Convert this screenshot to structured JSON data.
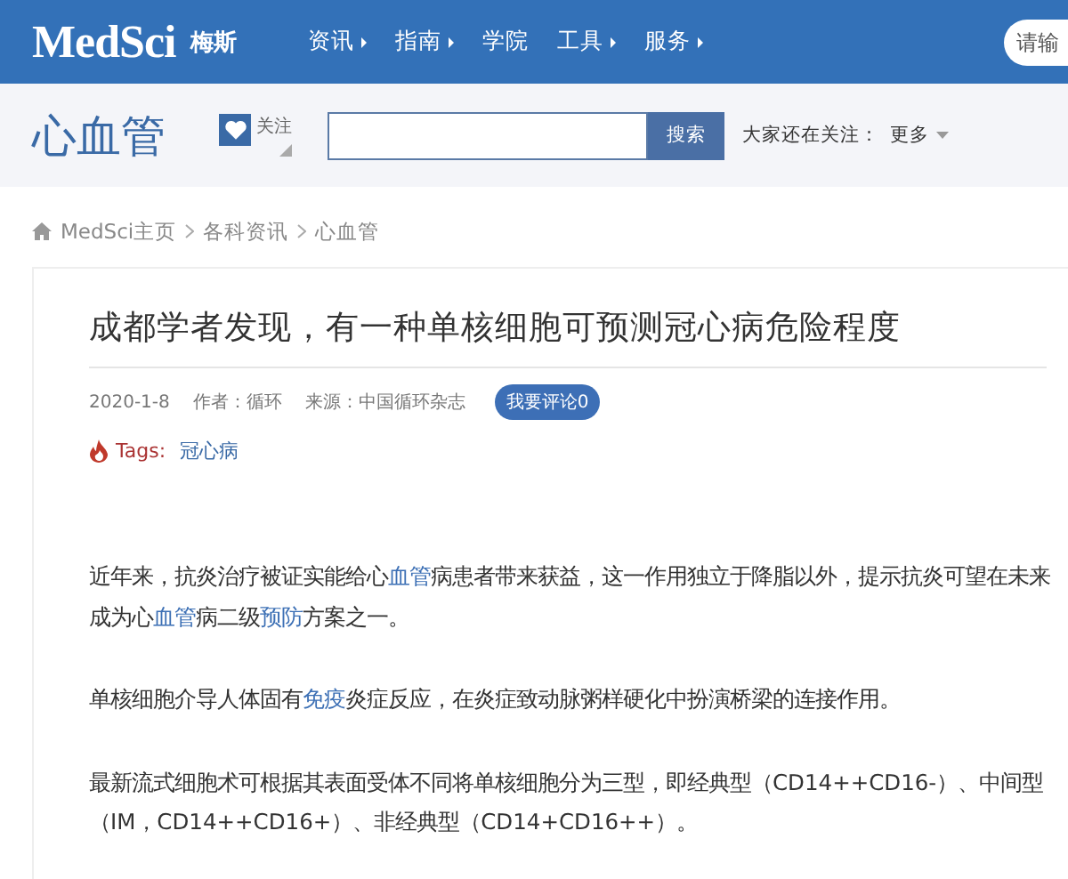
{
  "header": {
    "logo": "MedSci",
    "logo_cn": "梅斯",
    "nav": [
      {
        "label": "资讯",
        "has_menu": true
      },
      {
        "label": "指南",
        "has_menu": true
      },
      {
        "label": "学院",
        "has_menu": false
      },
      {
        "label": "工具",
        "has_menu": true
      },
      {
        "label": "服务",
        "has_menu": true
      }
    ],
    "search": {
      "placeholder": "请输"
    }
  },
  "channel": {
    "title": "心血管",
    "follow": "关注",
    "search_button": "搜索",
    "also_label": "大家还在关注：",
    "more": "更多"
  },
  "breadcrumb": [
    "MedSci主页",
    "各科资讯",
    "心血管"
  ],
  "article": {
    "title": "成都学者发现，有一种单核细胞可预测冠心病危险程度",
    "date": "2020-1-8",
    "author": "作者：循环",
    "source": "来源：中国循环杂志",
    "comment_button": "我要评论0",
    "tags_label": "Tags:",
    "tags": [
      "冠心病"
    ],
    "paragraphs": [
      [
        {
          "text": "近年来，抗炎治疗被证实能给心",
          "link": false
        },
        {
          "text": "血管",
          "link": true
        },
        {
          "text": "病患者带来获益，这一作用独立于降脂以外，提示抗炎可望在未来成为心",
          "link": false
        },
        {
          "text": "血管",
          "link": true
        },
        {
          "text": "病二级",
          "link": false
        },
        {
          "text": "预防",
          "link": true
        },
        {
          "text": "方案之一。",
          "link": false
        }
      ],
      [
        {
          "text": "单核细胞介导人体固有",
          "link": false
        },
        {
          "text": "免疫",
          "link": true
        },
        {
          "text": "炎症反应，在炎症致动脉粥样硬化中扮演桥梁的连接作用。",
          "link": false
        }
      ],
      [
        {
          "text": "最新流式细胞术可根据其表面受体不同将单核细胞分为三型，即经典型（CD14++CD16-）、中间型（IM，CD14++CD16+）、非经典型（CD14+CD16++）。",
          "link": false
        }
      ]
    ]
  }
}
